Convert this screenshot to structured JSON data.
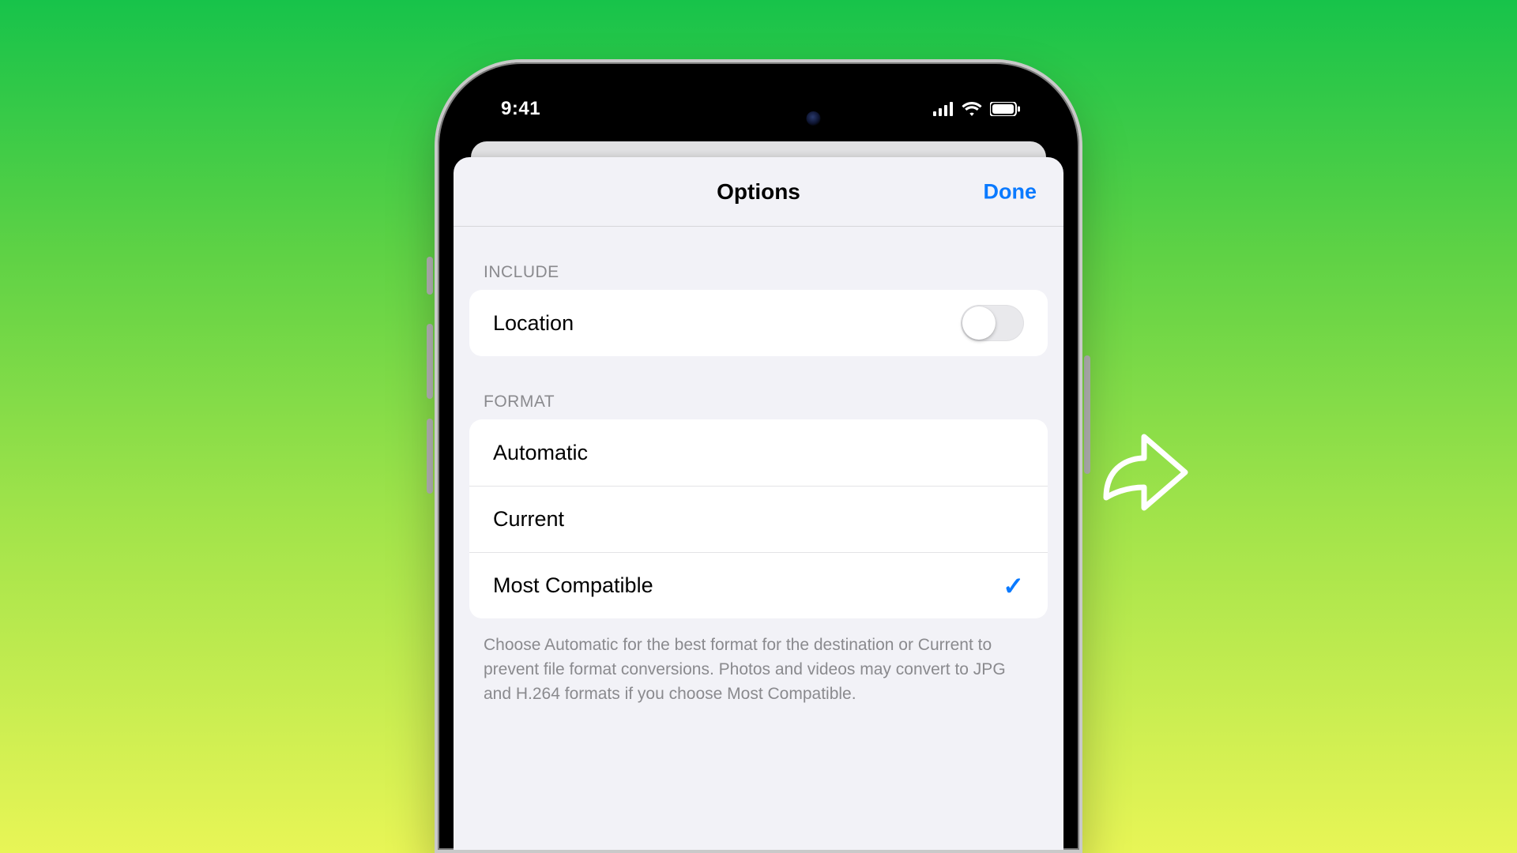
{
  "status": {
    "time": "9:41"
  },
  "header": {
    "title": "Options",
    "done": "Done"
  },
  "include": {
    "heading": "INCLUDE",
    "location_label": "Location",
    "location_on": false
  },
  "format": {
    "heading": "FORMAT",
    "options": [
      {
        "label": "Automatic",
        "selected": false
      },
      {
        "label": "Current",
        "selected": false
      },
      {
        "label": "Most Compatible",
        "selected": true
      }
    ],
    "footer": "Choose Automatic for the best format for the destination or Current to prevent file format conversions. Photos and videos may convert to JPG and H.264 formats if you choose Most Compatible."
  }
}
